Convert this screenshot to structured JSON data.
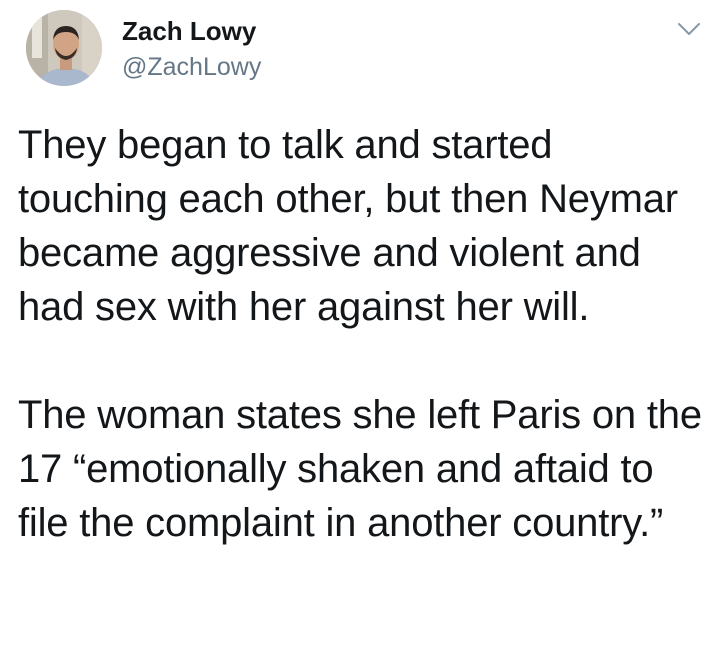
{
  "tweet": {
    "author": {
      "display_name": "Zach Lowy",
      "handle": "@ZachLowy",
      "avatar_icon": "user-avatar"
    },
    "menu_icon": "chevron-down-icon",
    "paragraphs": [
      "They began to talk and started touching each other, but then Neymar became aggressive and violent and had sex with her against her will.",
      "The woman states she left Paris on the 17 “emotionally shaken and aftaid to file the complaint in another country.”"
    ]
  },
  "colors": {
    "text_primary": "#14171a",
    "text_secondary": "#657786",
    "background": "#ffffff"
  }
}
